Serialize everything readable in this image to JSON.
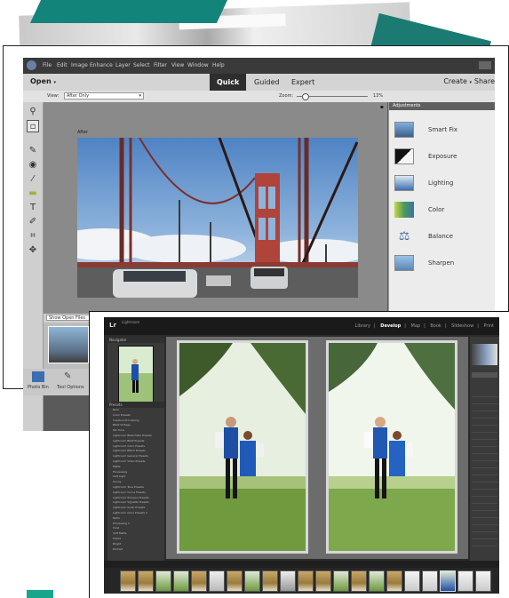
{
  "pse": {
    "menu": [
      "File",
      "Edit",
      "Image",
      "Enhance",
      "Layer",
      "Select",
      "Filter",
      "View",
      "Window",
      "Help"
    ],
    "open_label": "Open",
    "tabs": [
      {
        "label": "Quick",
        "active": true
      },
      {
        "label": "Guided",
        "active": false
      },
      {
        "label": "Expert",
        "active": false
      }
    ],
    "create_label": "Create",
    "share_label": "Share",
    "view_label": "View:",
    "view_value": "After Only",
    "zoom_label": "Zoom:",
    "zoom_value": "13%",
    "canvas_caption": "After",
    "adjustments": {
      "header": "Adjustments",
      "items": [
        {
          "label": "Smart Fix",
          "icon": "smart-fix-icon"
        },
        {
          "label": "Exposure",
          "icon": "exposure-icon"
        },
        {
          "label": "Lighting",
          "icon": "lighting-icon"
        },
        {
          "label": "Color",
          "icon": "color-icon"
        },
        {
          "label": "Balance",
          "icon": "balance-icon"
        },
        {
          "label": "Sharpen",
          "icon": "sharpen-icon"
        }
      ]
    },
    "bin_dropdown": "Show Open Files",
    "bottom": {
      "photo_bin": "Photo Bin",
      "tool_options": "Tool Options"
    }
  },
  "lr": {
    "logo": "Lr",
    "brand": "Lightroom",
    "modules": [
      {
        "label": "Library",
        "active": false
      },
      {
        "label": "Develop",
        "active": true
      },
      {
        "label": "Map",
        "active": false
      },
      {
        "label": "Book",
        "active": false
      },
      {
        "label": "Slideshow",
        "active": false
      },
      {
        "label": "Print",
        "active": false
      }
    ],
    "navigator_label": "Navigator",
    "presets_label": "Presets",
    "presets": [
      "Bold",
      "Color Presets",
      "Creative Processing",
      "B&W Vintage",
      "Tan Tone",
      "Lightroom B&W Filter Presets",
      "Lightroom B&W Presets",
      "Lightroom Color Presets",
      "Lightroom Effect Presets",
      "Lightroom General Presets",
      "Lightroom Video Presets",
      "Matte",
      "Processing",
      "Soft Light",
      "Sunny",
      "Lightroom Tone Presets",
      "Lightroom Curve Presets",
      "Lightroom Sharpen Presets",
      "Lightroom Vignette Presets",
      "Lightroom Grain Presets",
      "Lightroom Color Presets 2",
      "Retro",
      "Processing 2",
      "Vivid",
      "Soft Matte",
      "Faded",
      "Bright",
      "Portrait"
    ]
  },
  "colors": {
    "teal": "#13847a",
    "pse_dark": "#3a3a3a",
    "lr_dark": "#2b2b2b"
  }
}
